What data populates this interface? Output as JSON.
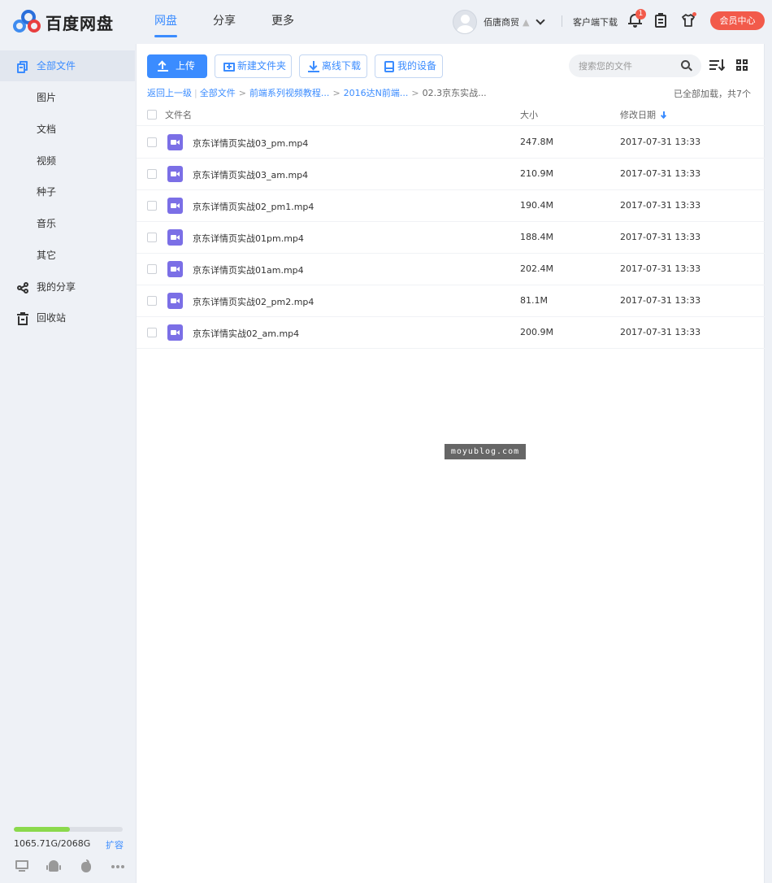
{
  "app": {
    "name": "百度网盘"
  },
  "topnav": {
    "items": [
      {
        "label": "网盘",
        "active": true
      },
      {
        "label": "分享",
        "active": false
      },
      {
        "label": "更多",
        "active": false
      }
    ]
  },
  "user": {
    "name": "佰唐商贸",
    "client_download": "客户端下载",
    "notification_count": "1",
    "vip_button": "会员中心"
  },
  "colors": {
    "accent": "#3b8cff",
    "vip": "#f25a4a",
    "video_icon": "#7b6fe6",
    "quota_fill": "#8bd94c"
  },
  "sidebar": {
    "items": [
      {
        "label": "全部文件",
        "icon": "files-icon",
        "active": true
      },
      {
        "label": "图片"
      },
      {
        "label": "文档"
      },
      {
        "label": "视频"
      },
      {
        "label": "种子"
      },
      {
        "label": "音乐"
      },
      {
        "label": "其它"
      },
      {
        "label": "我的分享",
        "icon": "share-icon"
      },
      {
        "label": "回收站",
        "icon": "trash-icon"
      }
    ],
    "quota": {
      "used_fraction": 0.515,
      "text": "1065.71G/2068G",
      "expand_label": "扩容"
    },
    "platform_icons": [
      "pc-icon",
      "android-icon",
      "apple-icon",
      "more-icon"
    ]
  },
  "toolbar": {
    "upload_label": "上传",
    "new_folder_label": "新建文件夹",
    "offline_download_label": "离线下载",
    "my_devices_label": "我的设备",
    "search_placeholder": "搜索您的文件"
  },
  "breadcrumb": {
    "back": "返回上一级",
    "all_files": "全部文件",
    "crumbs": [
      "前端系列视频教程...",
      "2016达N前端..."
    ],
    "current": "02.3京东实战..."
  },
  "list_status": "已全部加载，共7个",
  "columns": {
    "name": "文件名",
    "size": "大小",
    "date": "修改日期"
  },
  "files": [
    {
      "name": "京东详情页实战03_pm.mp4",
      "size": "247.8M",
      "date": "2017-07-31 13:33"
    },
    {
      "name": "京东详情页实战03_am.mp4",
      "size": "210.9M",
      "date": "2017-07-31 13:33"
    },
    {
      "name": "京东详情页实战02_pm1.mp4",
      "size": "190.4M",
      "date": "2017-07-31 13:33"
    },
    {
      "name": "京东详情页实战01pm.mp4",
      "size": "188.4M",
      "date": "2017-07-31 13:33"
    },
    {
      "name": "京东详情页实战01am.mp4",
      "size": "202.4M",
      "date": "2017-07-31 13:33"
    },
    {
      "name": "京东详情页实战02_pm2.mp4",
      "size": "81.1M",
      "date": "2017-07-31 13:33"
    },
    {
      "name": "京东详情实战02_am.mp4",
      "size": "200.9M",
      "date": "2017-07-31 13:33"
    }
  ],
  "watermark": "moyublog.com"
}
